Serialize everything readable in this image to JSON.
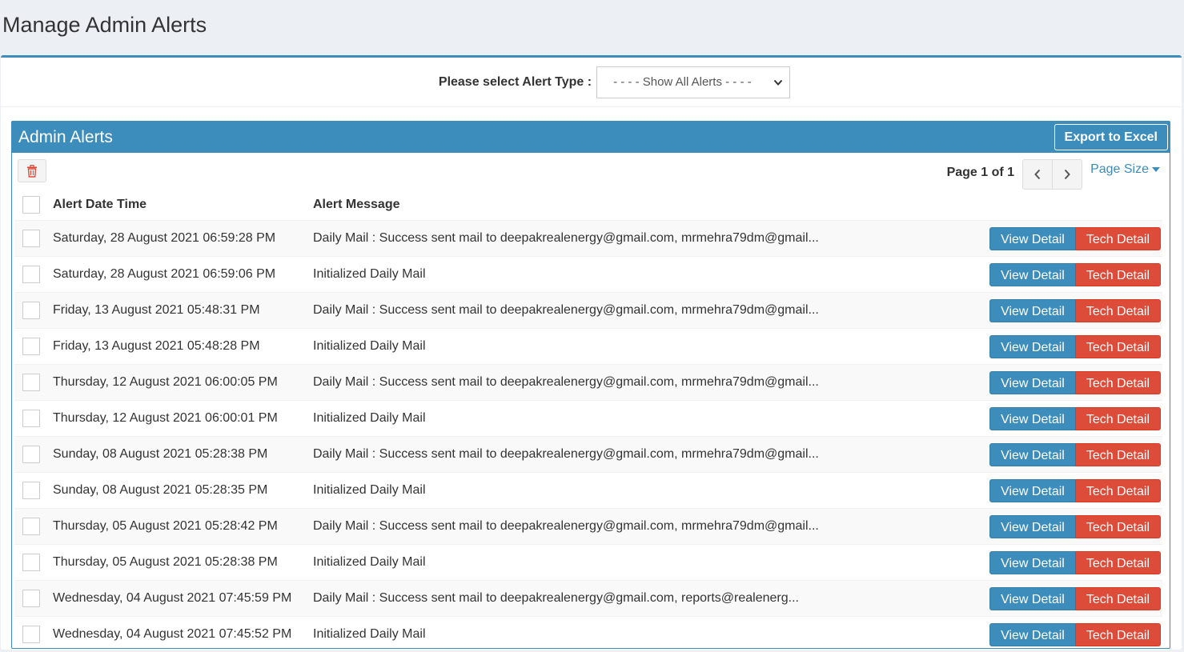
{
  "page": {
    "title": "Manage Admin Alerts"
  },
  "filter": {
    "label": "Please select Alert Type :",
    "selected": "- - - - Show All Alerts - - - -"
  },
  "panel": {
    "title": "Admin Alerts",
    "export_label": "Export to Excel"
  },
  "pager": {
    "page_text": "Page 1 of 1",
    "page_size_label": "Page Size"
  },
  "table": {
    "columns": [
      "Alert Date Time",
      "Alert Message"
    ],
    "view_label": "View Detail",
    "tech_label": "Tech Detail",
    "rows": [
      {
        "datetime": "Saturday, 28 August 2021 06:59:28 PM",
        "message": "Daily Mail : Success sent mail to deepakrealenergy@gmail.com, mrmehra79dm@gmail..."
      },
      {
        "datetime": "Saturday, 28 August 2021 06:59:06 PM",
        "message": "Initialized Daily Mail"
      },
      {
        "datetime": "Friday, 13 August 2021 05:48:31 PM",
        "message": "Daily Mail : Success sent mail to deepakrealenergy@gmail.com, mrmehra79dm@gmail..."
      },
      {
        "datetime": "Friday, 13 August 2021 05:48:28 PM",
        "message": "Initialized Daily Mail"
      },
      {
        "datetime": "Thursday, 12 August 2021 06:00:05 PM",
        "message": "Daily Mail : Success sent mail to deepakrealenergy@gmail.com, mrmehra79dm@gmail..."
      },
      {
        "datetime": "Thursday, 12 August 2021 06:00:01 PM",
        "message": "Initialized Daily Mail"
      },
      {
        "datetime": "Sunday, 08 August 2021 05:28:38 PM",
        "message": "Daily Mail : Success sent mail to deepakrealenergy@gmail.com, mrmehra79dm@gmail..."
      },
      {
        "datetime": "Sunday, 08 August 2021 05:28:35 PM",
        "message": "Initialized Daily Mail"
      },
      {
        "datetime": "Thursday, 05 August 2021 05:28:42 PM",
        "message": "Daily Mail : Success sent mail to deepakrealenergy@gmail.com, mrmehra79dm@gmail..."
      },
      {
        "datetime": "Thursday, 05 August 2021 05:28:38 PM",
        "message": "Initialized Daily Mail"
      },
      {
        "datetime": "Wednesday, 04 August 2021 07:45:59 PM",
        "message": "Daily Mail : Success sent mail to deepakrealenergy@gmail.com, reports@realenerg..."
      },
      {
        "datetime": "Wednesday, 04 August 2021 07:45:52 PM",
        "message": "Initialized Daily Mail"
      }
    ]
  },
  "icons": {
    "delete": "trash-icon",
    "prev": "chevron-left-icon",
    "next": "chevron-right-icon",
    "dropdown": "caret-down-icon",
    "select": "chevron-down-icon"
  },
  "colors": {
    "primary": "#3c8dbc",
    "danger": "#dd4b39",
    "background": "#ecf0f5"
  }
}
